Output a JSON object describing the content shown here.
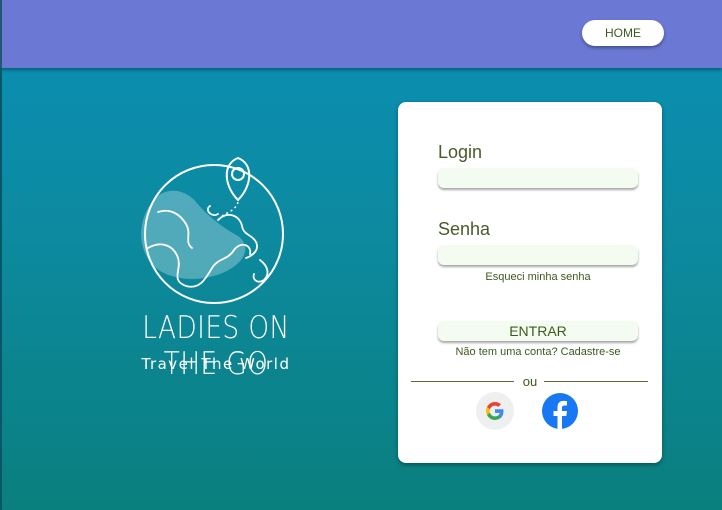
{
  "header": {
    "home_label": "HOME"
  },
  "brand": {
    "name": "LADIES ON THE GO",
    "tagline": "Travel The World"
  },
  "login_form": {
    "login_label": "Login",
    "login_value": "",
    "password_label": "Senha",
    "password_value": "",
    "forgot_password": "Esqueci minha senha",
    "submit_label": "ENTRAR",
    "signup_prompt": "Não tem uma conta? Cadastre-se",
    "separator": "ou"
  },
  "social_logins": [
    {
      "icon": "google-icon"
    },
    {
      "icon": "facebook-icon"
    }
  ],
  "colors": {
    "header_bg": "#6b78d4",
    "bg_top": "#0a8fb5",
    "bg_bottom": "#0a7f7e",
    "text_accent": "#3c5a1e",
    "facebook_blue": "#1877f2"
  }
}
